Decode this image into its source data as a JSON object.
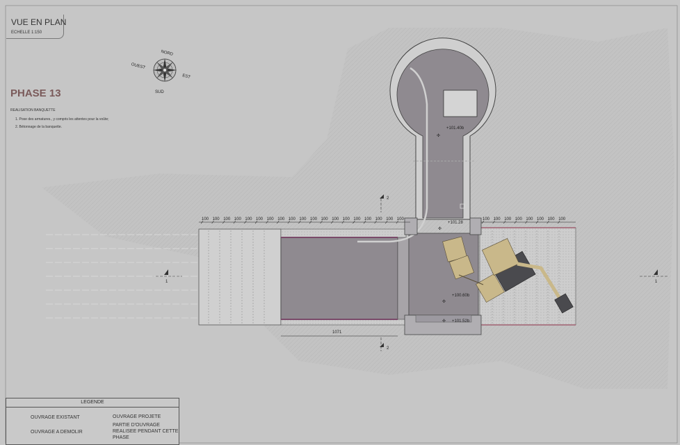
{
  "title": {
    "main": "VUE EN PLAN",
    "scale": "ECHELLE  1:150"
  },
  "compass": {
    "north": "NORD",
    "south": "SUD",
    "east": "EST",
    "west": "OUEST"
  },
  "phase": {
    "title": "PHASE 13",
    "subtitle": "REALISATION BANQUETTE",
    "steps": [
      "1.   Pose des armatures., y compris les attentes pour la voûte;",
      "2.   Bétonnage de la banquette."
    ]
  },
  "dimensions": {
    "spacing_label": "100",
    "length_label": "1071"
  },
  "levels": {
    "shaft": "+101.40b",
    "entry": "+101.28",
    "floor": "+100.60b",
    "bottom": "+101.52b"
  },
  "sections": {
    "section_1": "1",
    "section_2": "2"
  },
  "legend": {
    "header": "LEGENDE",
    "existing": "OUVRAGE EXISTANT",
    "demolish": "OUVRAGE A  DEMOLIR",
    "projected": "OUVRAGE PROJETE",
    "partial_line1": "PARTIE D'OUVRAGE",
    "partial_line2": "REALISEE PENDANT CETTE",
    "partial_line3": "PHASE"
  },
  "colors": {
    "background": "#c6c6c6",
    "existing": "#8f8a90",
    "demolish": "#b89aa0",
    "phase_title": "#7a5a5a",
    "excavator": "#c9b88a"
  }
}
